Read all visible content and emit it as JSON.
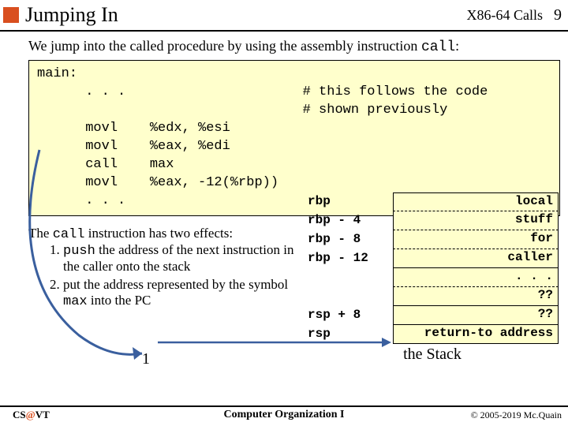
{
  "header": {
    "title": "Jumping In",
    "subtitle": "X86-64 Calls",
    "pagenum": "9"
  },
  "intro": {
    "pre": "We jump into the called procedure by using the assembly instruction ",
    "code": "call",
    "post": ":"
  },
  "code": {
    "l1": "main:",
    "l2": "      . . .                      # this follows the code",
    "l3": "                                 # shown previously",
    "l4": "      movl    %edx, %esi",
    "l5": "      movl    %eax, %edi",
    "l6": "      call    max",
    "l7": "      movl    %eax, -12(%rbp))",
    "l8": "      . . ."
  },
  "effects": {
    "line": {
      "a": "The ",
      "b": "call",
      "c": " instruction has two effects:"
    },
    "item1a": "push",
    "item1b": " the address of the next instruction in the caller onto the stack",
    "item2a": "put the address represented by the symbol ",
    "item2b": "max",
    "item2c": " into the PC"
  },
  "stack": {
    "r1": {
      "label": "rbp",
      "val": "local"
    },
    "r2": {
      "label": "rbp -  4",
      "val": "stuff"
    },
    "r3": {
      "label": "rbp -  8",
      "val": "for"
    },
    "r4": {
      "label": "rbp - 12",
      "val": "caller"
    },
    "r5": {
      "label": "",
      "val": ". . ."
    },
    "r6": {
      "label": "",
      "val": "??"
    },
    "r7": {
      "label": "rsp +  8",
      "val": "??"
    },
    "r8": {
      "label": "rsp",
      "val": "return-to address"
    },
    "caption": "the Stack"
  },
  "annotation": {
    "one": "1"
  },
  "footer": {
    "left_a": "CS",
    "left_at": "@",
    "left_b": "VT",
    "center": "Computer Organization I",
    "right": "© 2005-2019 Mc.Quain"
  }
}
